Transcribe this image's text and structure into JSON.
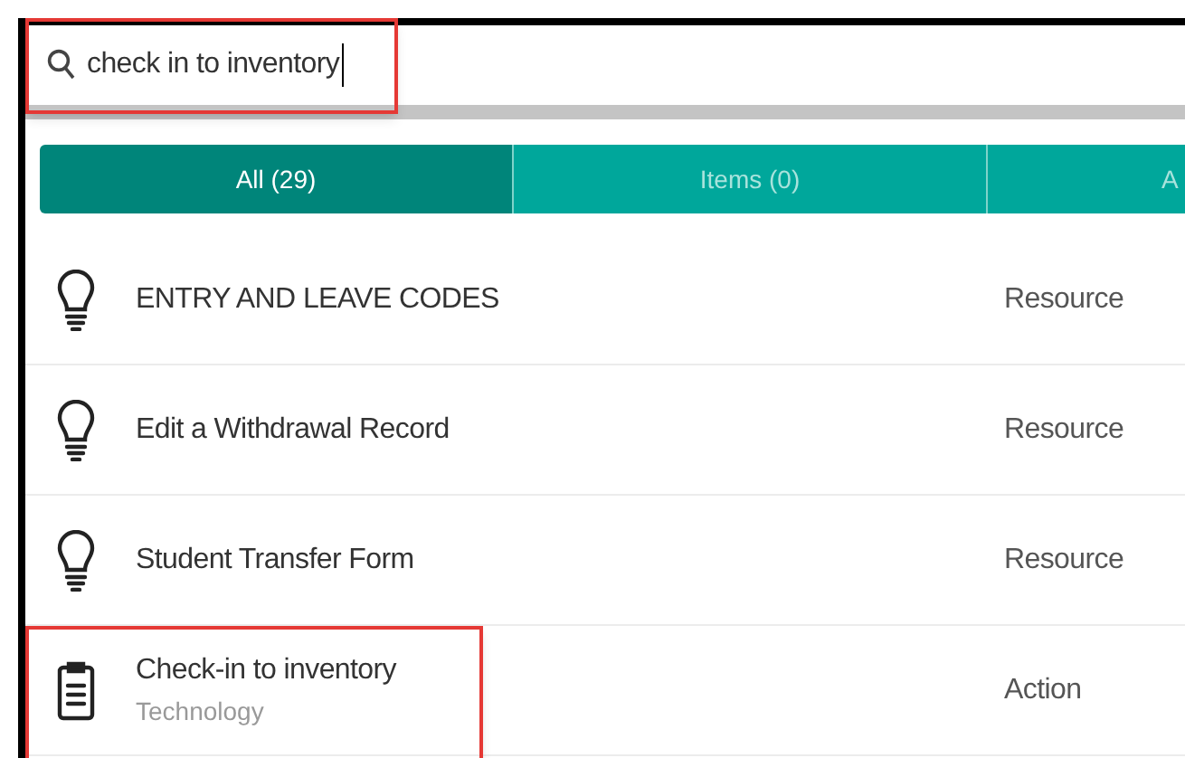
{
  "search": {
    "value": "check in to inventory",
    "highlighted": true
  },
  "tabs": [
    {
      "label": "All (29)",
      "selected": true
    },
    {
      "label": "Items (0)",
      "selected": false
    },
    {
      "label": "A",
      "selected": false
    }
  ],
  "results": [
    {
      "kind": "resource",
      "title": "ENTRY AND LEAVE CODES",
      "type": "Resource",
      "highlighted": false
    },
    {
      "kind": "resource",
      "title": "Edit a Withdrawal Record",
      "type": "Resource",
      "highlighted": false
    },
    {
      "kind": "resource",
      "title": "Student Transfer Form",
      "type": "Resource",
      "highlighted": false
    },
    {
      "kind": "action",
      "title": "Check-in to inventory",
      "subtitle": "Technology",
      "type": "Action",
      "highlighted": true
    }
  ]
}
